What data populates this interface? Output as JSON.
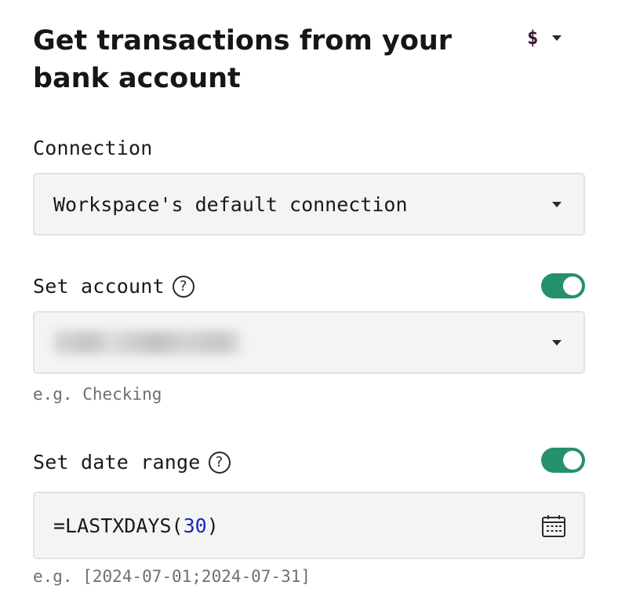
{
  "header": {
    "title": "Get transactions from your bank account",
    "currency_symbol": "$"
  },
  "connection": {
    "label": "Connection",
    "value": "Workspace's default connection"
  },
  "account": {
    "label": "Set account",
    "help": "?",
    "toggle_on": true,
    "value_blurred": true,
    "helper": "e.g. Checking"
  },
  "date_range": {
    "label": "Set date range",
    "help": "?",
    "toggle_on": true,
    "formula_prefix": "=LASTXDAYS(",
    "formula_number": "30",
    "formula_suffix": ")",
    "helper": "e.g. [2024-07-01;2024-07-31]"
  },
  "icons": {
    "help": "question-circle-icon",
    "dropdown": "chevron-down-icon",
    "calendar": "calendar-icon"
  },
  "colors": {
    "toggle_on": "#24916a",
    "formula_number": "#1d28b6",
    "currency": "#3b1430"
  }
}
